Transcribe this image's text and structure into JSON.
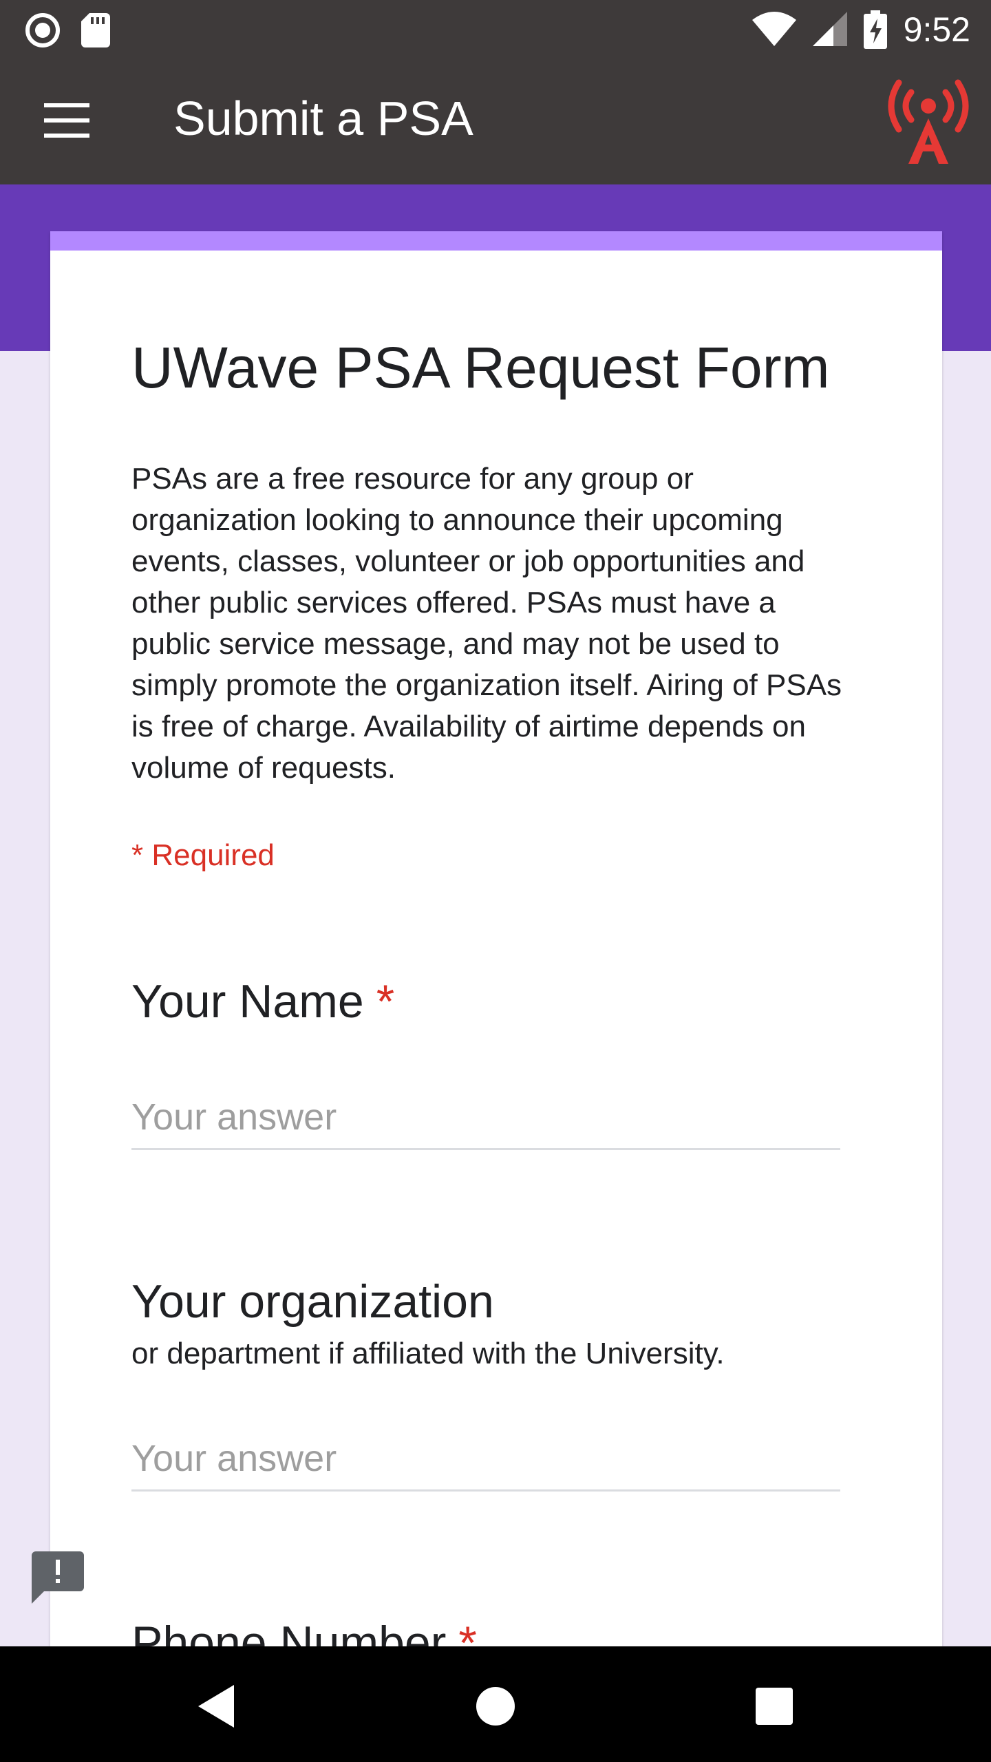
{
  "status_bar": {
    "time": "9:52",
    "icons": [
      "record-icon",
      "sd-card-icon",
      "wifi-icon",
      "signal-icon",
      "battery-charging-icon"
    ]
  },
  "app_bar": {
    "title": "Submit a PSA",
    "menu_icon": "hamburger-menu-icon",
    "logo_icon": "radio-tower-icon",
    "logo_color": "#e53935"
  },
  "colors": {
    "app_bar": "#3e3a3a",
    "header_band": "#673ab7",
    "card_accent": "#b388ff",
    "required": "#d93025",
    "background": "#ede7f6"
  },
  "form": {
    "title": "UWave PSA Request Form",
    "description": "PSAs are a free resource for any group or organization looking to announce their upcoming events, classes, volunteer or job opportunities and other public services offered. PSAs must have a public service message, and may not be used to simply promote the organization itself. Airing of PSAs is free of charge. Availability of airtime depends on volume of requests.",
    "required_note": "* Required",
    "questions": [
      {
        "title": "Your Name",
        "required": "*",
        "placeholder": "Your answer",
        "value": ""
      },
      {
        "title": "Your organization",
        "description": "or department if affiliated with the University.",
        "placeholder": "Your answer",
        "value": ""
      },
      {
        "title": "Phone Number",
        "required": "*"
      }
    ]
  },
  "feedback_icon": "feedback-icon",
  "nav_bar": {
    "buttons": [
      "back-icon",
      "home-icon",
      "recents-icon"
    ]
  }
}
